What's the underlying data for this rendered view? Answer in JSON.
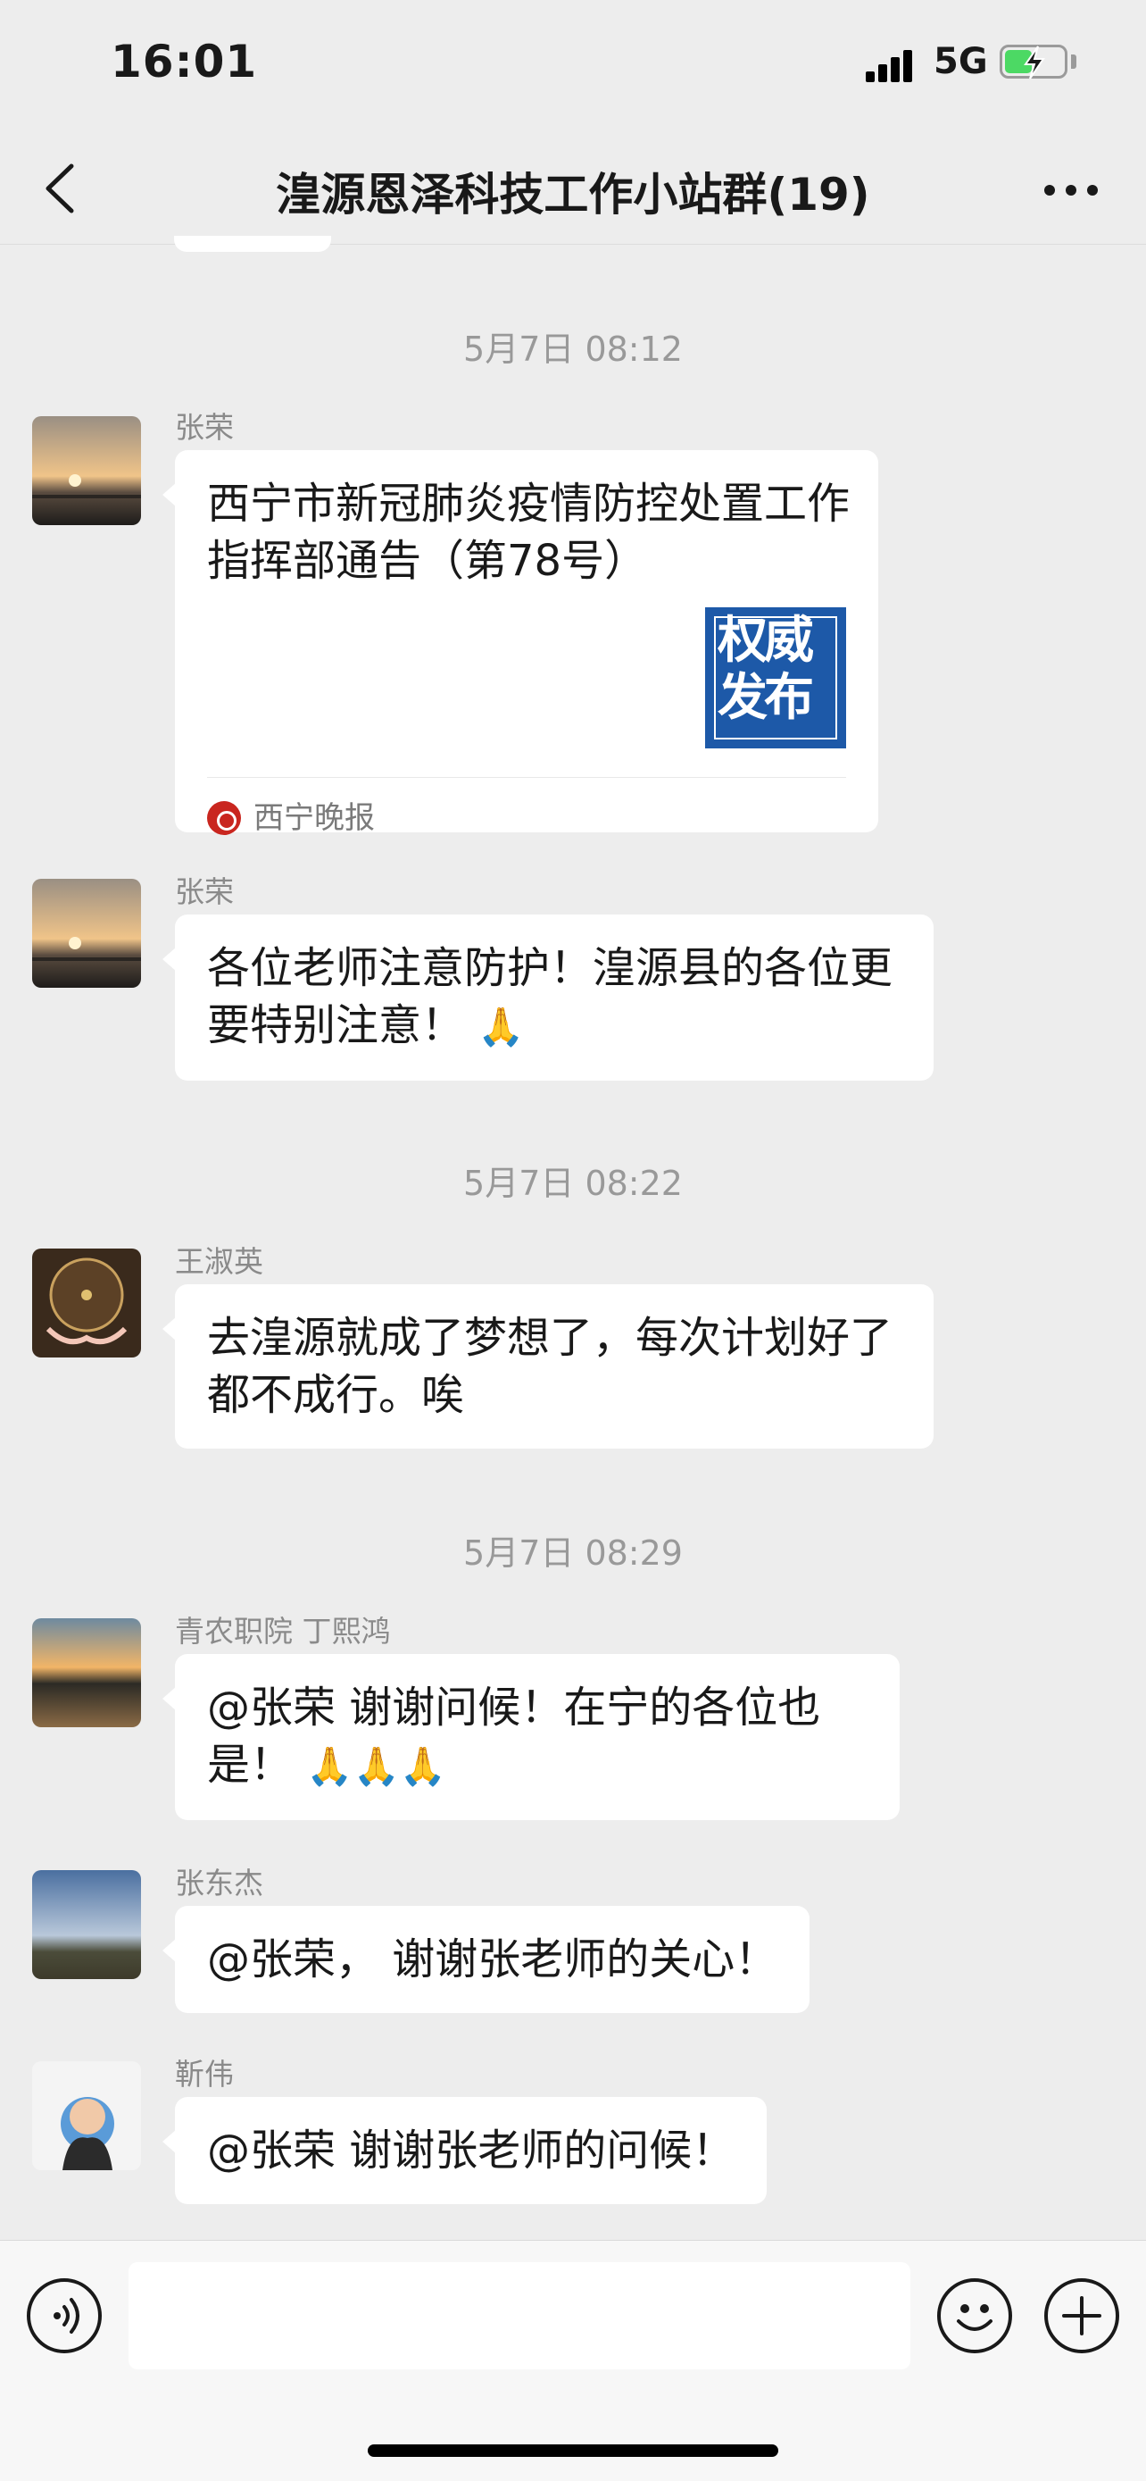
{
  "status_bar": {
    "time": "16:01",
    "network": "5G"
  },
  "nav": {
    "title": "湟源恩泽科技工作小站群(19)"
  },
  "messages": [
    {
      "timestamp": "5月7日 08:12"
    },
    {
      "sender": "张荣",
      "card": {
        "title": "西宁市新冠肺炎疫情防控处置工作指挥部通告（第78号）",
        "thumb_text": "权威发布",
        "source": "西宁晚报"
      }
    },
    {
      "sender": "张荣",
      "text": "各位老师注意防护！湟源县的各位更要特别注意！",
      "emoji": "🙏"
    },
    {
      "timestamp": "5月7日 08:22"
    },
    {
      "sender": "王淑英",
      "text": "去湟源就成了梦想了，每次计划好了都不成行。唉"
    },
    {
      "timestamp": "5月7日 08:29"
    },
    {
      "sender": "青农职院 丁熙鸿",
      "text": "@张荣 谢谢问候！在宁的各位也是！",
      "emoji": "🙏🙏🙏"
    },
    {
      "sender": "张东杰",
      "text": "@张荣， 谢谢张老师的关心！"
    },
    {
      "sender": "靳伟",
      "text": "@张荣 谢谢张老师的问候！"
    }
  ],
  "input": {
    "value": "",
    "placeholder": ""
  },
  "colors": {
    "background": "#ededed",
    "bubble": "#ffffff",
    "timestamp": "#999999",
    "card_thumb": "#1d59a8"
  }
}
